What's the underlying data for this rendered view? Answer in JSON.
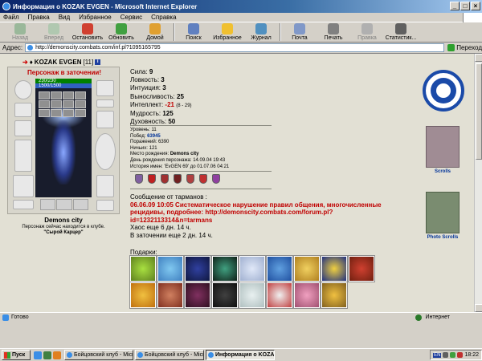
{
  "window": {
    "title": "Информация о KOZAK EVGEN - Microsoft Internet Explorer"
  },
  "menu": [
    "Файл",
    "Правка",
    "Вид",
    "Избранное",
    "Сервис",
    "Справка"
  ],
  "toolbar": {
    "back": "Назад",
    "forward": "Вперед",
    "stop": "Остановить",
    "refresh": "Обновить",
    "home": "Домой",
    "search": "Поиск",
    "favorites": "Избранное",
    "history": "Журнал",
    "mail": "Почта",
    "print": "Печать",
    "edit": "Правка",
    "stats": "Статистик..."
  },
  "address": {
    "label": "Адрес:",
    "url": "http://demonscity.combats.com/inf.pl?1095165795",
    "go": "Переход"
  },
  "character": {
    "name": "KOZAK EVGEN",
    "level": "[11]",
    "status": "Персонаж в заточении!",
    "hp": "230/230",
    "mana": "1500/1500",
    "city": "Demons city",
    "club_line": "Персонаж сейчас находится в клубе.",
    "cell": "\"Сырой Карцер\""
  },
  "stats": [
    {
      "label": "Сила:",
      "value": "9"
    },
    {
      "label": "Ловкость:",
      "value": "3"
    },
    {
      "label": "Интуиция:",
      "value": "3"
    },
    {
      "label": "Выносливость:",
      "value": "25"
    },
    {
      "label": "Интеллект:",
      "value": "-21",
      "extra": "(8 - 29)"
    },
    {
      "label": "Мудрость:",
      "value": "125"
    },
    {
      "label": "Духовность:",
      "value": "50"
    }
  ],
  "info": {
    "level": "Уровень: 11",
    "wins_label": "Побед:",
    "wins": "63945",
    "losses": "Поражений: 6390",
    "draws": "Ничьих: 121",
    "birthplace_label": "Место рождения:",
    "birthplace": "Demons city",
    "birthday": "День рождения персонажа: 14.09.04 19:43",
    "name_history": "История имен: 'EvGEN 69' до 01.07.06 04:21"
  },
  "message": {
    "header": "Сообщение от тарманов :",
    "text": "06.06.09 10:05 Систематическое нарушение правил общения, многочисленные рецидивы, подробнее: http://demonscity.combats.com/forum.pl?id=1232113314&n=tarmans",
    "chaos": "Хаос еще 6 дн. 14 ч.",
    "jail": "В заточении еще 2 дн. 14 ч."
  },
  "gifts_label": "Подарки:",
  "scrolls": {
    "first": "Scrolls",
    "second": "Photo Scrolls"
  },
  "status": {
    "ready": "Готово",
    "zone": "Интернет"
  },
  "taskbar": {
    "start": "Пуск",
    "tasks": [
      "Бойцовский клуб - Micr...",
      "Бойцовский клуб - Micr...",
      "Информация о KOZAK..."
    ],
    "lang": "EN",
    "time": "18:22"
  },
  "colors": {
    "accent": "#c00000",
    "link": "#003399",
    "hp": "#008000",
    "mana": "#3060c0"
  }
}
